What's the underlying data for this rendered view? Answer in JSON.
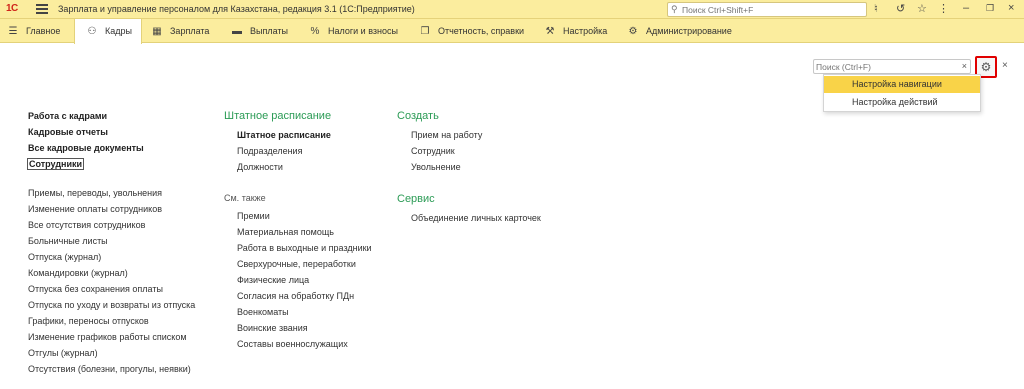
{
  "titlebar": {
    "logo": "1С",
    "title": "Зарплата и управление персоналом для Казахстана, редакция 3.1  (1С:Предприятие)",
    "search_placeholder": "Поиск Ctrl+Shift+F",
    "icons": [
      "bell-icon",
      "history-icon",
      "star-icon",
      "more-icon",
      "minimize-icon",
      "restore-icon",
      "close-icon"
    ]
  },
  "tabs": [
    {
      "label": "Главное",
      "icon": "menu-lines-icon",
      "active": false
    },
    {
      "label": "Кадры",
      "icon": "people-icon",
      "active": true
    },
    {
      "label": "Зарплата",
      "icon": "calculator-icon",
      "active": false
    },
    {
      "label": "Выплаты",
      "icon": "wallet-icon",
      "active": false
    },
    {
      "label": "Налоги и взносы",
      "icon": "percent-icon",
      "active": false
    },
    {
      "label": "Отчетность, справки",
      "icon": "reports-icon",
      "active": false
    },
    {
      "label": "Настройка",
      "icon": "wrench-icon",
      "active": false
    },
    {
      "label": "Администрирование",
      "icon": "gear-icon",
      "active": false
    }
  ],
  "panel": {
    "search_placeholder": "Поиск (Ctrl+F)",
    "clear_glyph": "×",
    "close_glyph": "×",
    "menu": [
      {
        "label": "Настройка навигации",
        "highlighted": true
      },
      {
        "label": "Настройка действий",
        "highlighted": false
      }
    ]
  },
  "col1": {
    "top": [
      "Работа с кадрами",
      "Кадровые отчеты",
      "Все кадровые документы",
      "Сотрудники"
    ],
    "items": [
      "Приемы, переводы, увольнения",
      "Изменение оплаты сотрудников",
      "Все отсутствия сотрудников",
      "Больничные листы",
      "Отпуска (журнал)",
      "Командировки (журнал)",
      "Отпуска без сохранения оплаты",
      "Отпуска по уходу и возвраты из отпуска",
      "Графики, переносы отпусков",
      "Изменение графиков работы списком",
      "Отгулы (журнал)",
      "Отсутствия (болезни, прогулы, неявки)"
    ]
  },
  "col2": {
    "heading": "Штатное расписание",
    "items": [
      "Штатное расписание",
      "Подразделения",
      "Должности"
    ],
    "see_also": "См. также",
    "see_items": [
      "Премии",
      "Материальная помощь",
      "Работа в выходные и праздники",
      "Сверхурочные, переработки",
      "Физические лица",
      "Согласия на обработку ПДн",
      "Военкоматы",
      "Воинские звания",
      "Составы военнослужащих"
    ]
  },
  "col3": {
    "create_heading": "Создать",
    "create_items": [
      "Прием на работу",
      "Сотрудник",
      "Увольнение"
    ],
    "service_heading": "Сервис",
    "service_items": [
      "Объединение личных карточек"
    ]
  }
}
